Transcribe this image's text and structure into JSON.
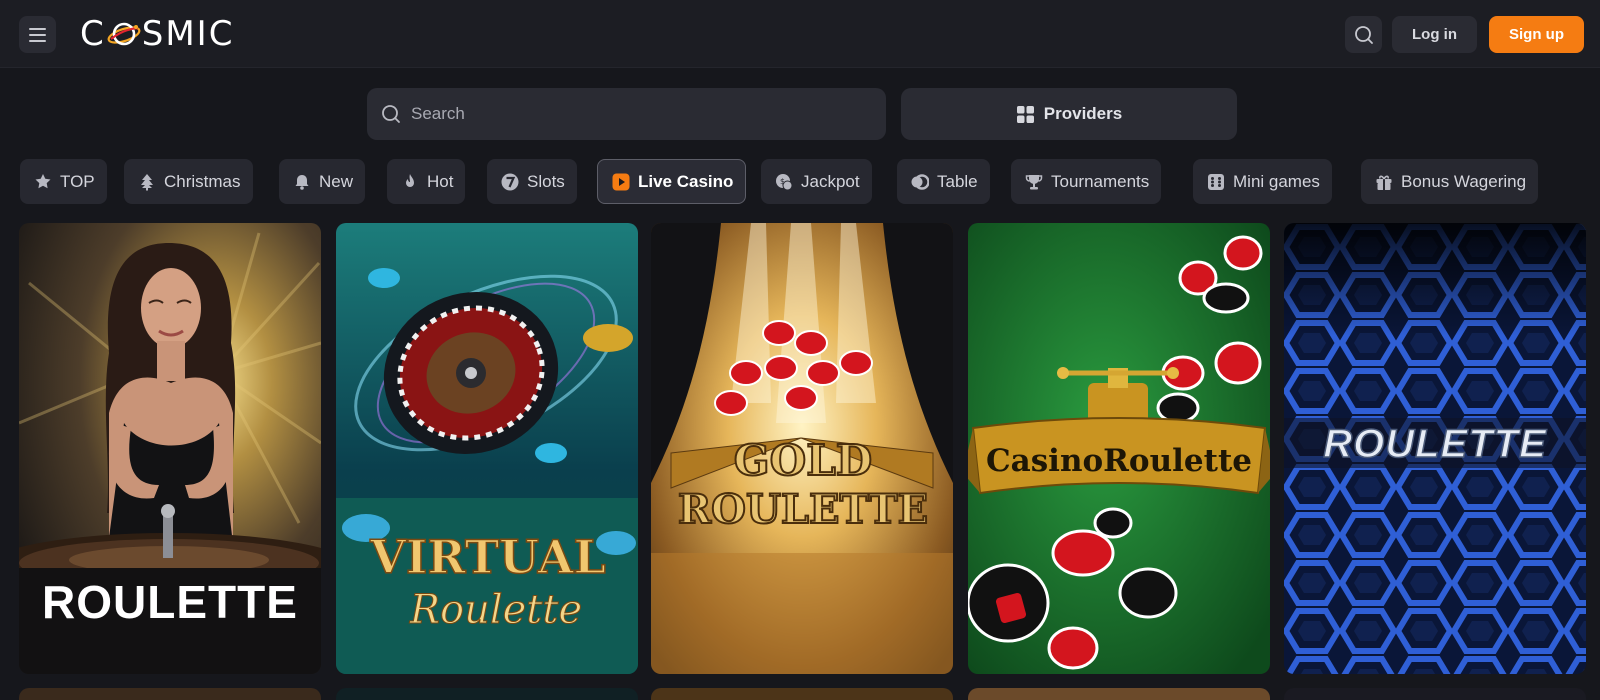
{
  "brand": {
    "logo_text": "COSMIC",
    "accent": "#f57c12"
  },
  "header": {
    "menu_icon": "hamburger-icon",
    "search_icon": "search-icon",
    "login_label": "Log in",
    "signup_label": "Sign up"
  },
  "search": {
    "placeholder": "Search",
    "value": ""
  },
  "providers": {
    "label": "Providers",
    "icon": "grid-icon"
  },
  "categories": [
    {
      "label": "TOP",
      "icon": "star-badge-icon",
      "active": false
    },
    {
      "label": "Christmas",
      "icon": "tree-icon",
      "active": false
    },
    {
      "label": "New",
      "icon": "bell-icon",
      "active": false
    },
    {
      "label": "Hot",
      "icon": "flame-icon",
      "active": false
    },
    {
      "label": "Slots",
      "icon": "seven-icon",
      "active": false
    },
    {
      "label": "Live Casino",
      "icon": "play-icon",
      "active": true
    },
    {
      "label": "Jackpot",
      "icon": "coins-icon",
      "active": false
    },
    {
      "label": "Table",
      "icon": "chip-icon",
      "active": false
    },
    {
      "label": "Tournaments",
      "icon": "trophy-icon",
      "active": false
    },
    {
      "label": "Mini games",
      "icon": "dice-icon",
      "active": false
    },
    {
      "label": "Bonus Wagering",
      "icon": "gift-icon",
      "active": false
    }
  ],
  "games": [
    {
      "title": "ROULETTE"
    },
    {
      "title_line1": "VIRTUAL",
      "title_line2": "Roulette"
    },
    {
      "title_line1": "GOLD",
      "title_line2": "ROULETTE"
    },
    {
      "title": "CasinoRoulette"
    },
    {
      "title": "ROULETTE"
    }
  ]
}
